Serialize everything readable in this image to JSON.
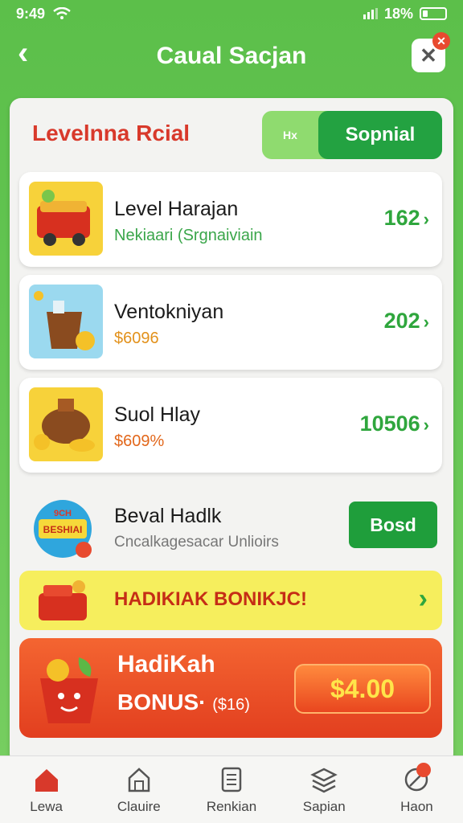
{
  "status": {
    "time": "9:49",
    "battery": "18%"
  },
  "header": {
    "title": "Caual Sacjan",
    "back_label": "‹",
    "close_label": "✕"
  },
  "panel": {
    "title": "Levelnna Rcial",
    "toggle": {
      "option_a": "Hx",
      "option_b": "Sopnial"
    }
  },
  "cards": [
    {
      "name": "Level Harajan",
      "sub": "Nekiaari (Srgnaiviain",
      "value": "162",
      "sub_color": "#3aa64a"
    },
    {
      "name": "Ventokniyan",
      "sub": "$6096",
      "value": "202",
      "sub_color": "#e2911b"
    },
    {
      "name": "Suol Hlay",
      "sub": "$609%",
      "value": "10506",
      "sub_color": "#e2671b"
    }
  ],
  "card4": {
    "name": "Beval Hadlk",
    "sub": "Cncalkagesacar Unlioirs",
    "button": "Bosd",
    "badge_text_1": "9CH",
    "badge_text_2": "BESHIAI"
  },
  "yellow_banner": {
    "text": "HADIKIAK BONIKJC!"
  },
  "red_banner": {
    "line1": "HadiKah",
    "line2": "BONUS·",
    "line2_small": "($16)",
    "amount": "$4.00"
  },
  "nav": [
    {
      "label": "Lewa",
      "icon": "home-icon"
    },
    {
      "label": "Clauire",
      "icon": "store-icon"
    },
    {
      "label": "Renkian",
      "icon": "list-icon"
    },
    {
      "label": "Sapian",
      "icon": "stack-icon"
    },
    {
      "label": "Haon",
      "icon": "profile-icon"
    }
  ],
  "colors": {
    "brand_green": "#5cbf4a",
    "accent_red": "#d8392b",
    "button_green": "#1f9e3b"
  }
}
